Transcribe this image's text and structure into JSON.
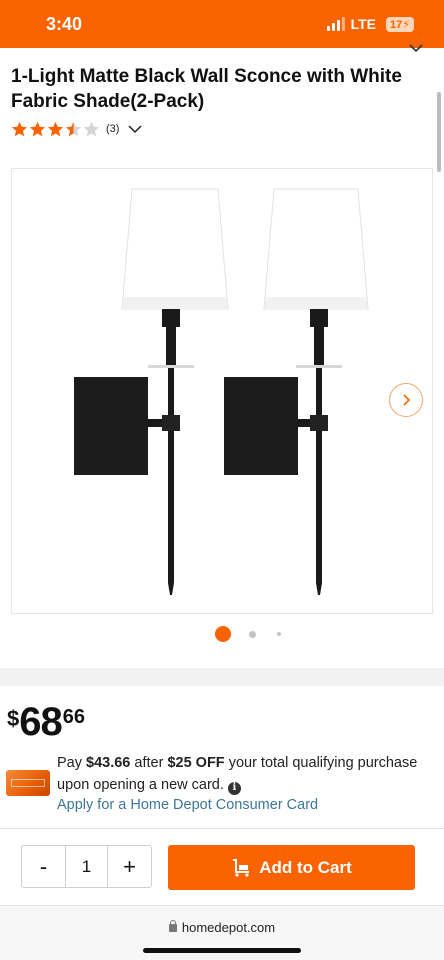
{
  "status_bar": {
    "time": "3:40",
    "network": "LTE",
    "battery": "17",
    "colors": {
      "background": "#f96302"
    }
  },
  "product": {
    "title": "1-Light Matte Black Wall Sconce with White Fabric Shade(2-Pack)",
    "rating": 3.5,
    "rating_max": 5,
    "review_count": "(3)",
    "image_count": 3,
    "active_image_index": 0
  },
  "price": {
    "currency": "$",
    "dollars": "68",
    "cents": "66"
  },
  "promo": {
    "pay_prefix": "Pay ",
    "discounted_amount": "$43.66",
    "after_text": " after ",
    "discount": "$25 OFF",
    "rest_text": " your total qualifying purchase upon opening a new card.",
    "apply_link": "Apply for a Home Depot Consumer Card"
  },
  "cart": {
    "decrement_label": "-",
    "quantity": "1",
    "increment_label": "+",
    "add_to_cart_label": "Add to Cart"
  },
  "browser": {
    "url": "homedepot.com"
  },
  "icons": {
    "star": "star-icon",
    "chevron": "chevron-down-icon",
    "next": "chevron-right-icon",
    "info": "info-icon",
    "cart": "cart-icon",
    "lock": "lock-icon"
  },
  "colors": {
    "brand": "#f96302",
    "link": "#3e7697",
    "star": "#f96302"
  }
}
